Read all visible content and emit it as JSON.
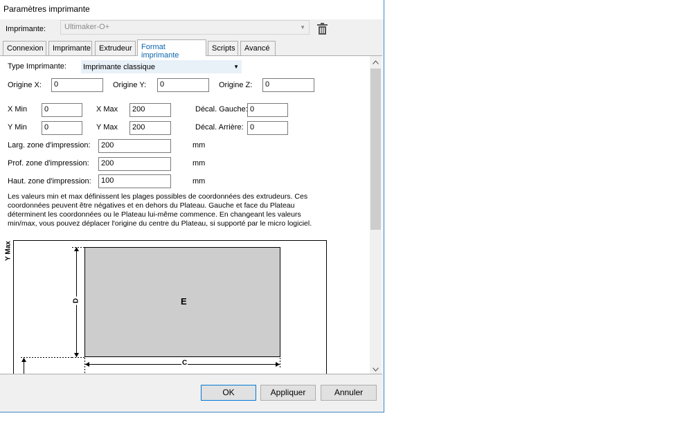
{
  "window": {
    "title": "Paramètres imprimante"
  },
  "printer": {
    "label": "Imprimante:",
    "value": "Ultimaker-O+"
  },
  "tabs": [
    "Connexion",
    "Imprimante",
    "Extrudeur",
    "Format imprimante",
    "Scripts",
    "Avancé"
  ],
  "form": {
    "type_label": "Type Imprimante:",
    "type_value": "Imprimante classique",
    "origin_x_label": "Origine X:",
    "origin_x": "0",
    "origin_y_label": "Origine Y:",
    "origin_y": "0",
    "origin_z_label": "Origine Z:",
    "origin_z": "0",
    "xmin_label": "X Min",
    "xmin": "0",
    "xmax_label": "X Max",
    "xmax": "200",
    "decal_gauche_label": "Décal. Gauche:",
    "decal_gauche": "0",
    "ymin_label": "Y Min",
    "ymin": "0",
    "ymax_label": "Y Max",
    "ymax": "200",
    "decal_arriere_label": "Décal. Arrière:",
    "decal_arriere": "0",
    "larg_label": "Larg. zone d'impression:",
    "larg": "200",
    "larg_unit": "mm",
    "prof_label": "Prof. zone d'impression:",
    "prof": "200",
    "prof_unit": "mm",
    "haut_label": "Haut. zone d'impression:",
    "haut": "100",
    "haut_unit": "mm"
  },
  "description_lines": [
    "Les valeurs min et max définissent les plages possibles de coordonnées des extrudeurs. Ces",
    "coordonnées peuvent être négatives et en dehors du Plateau. Gauche et face du Plateau",
    "déterminent les coordonnées ou le Plateau lui-même commence. En changeant les valeurs",
    "min/max, vous pouvez déplacer l'origine du centre du Plateau, si supporté par le micro logiciel."
  ],
  "diagram": {
    "ymax_label": "Y Max",
    "d_label": "D",
    "c_label": "C",
    "e_label": "E"
  },
  "buttons": {
    "ok": "OK",
    "apply": "Appliquer",
    "cancel": "Annuler"
  }
}
